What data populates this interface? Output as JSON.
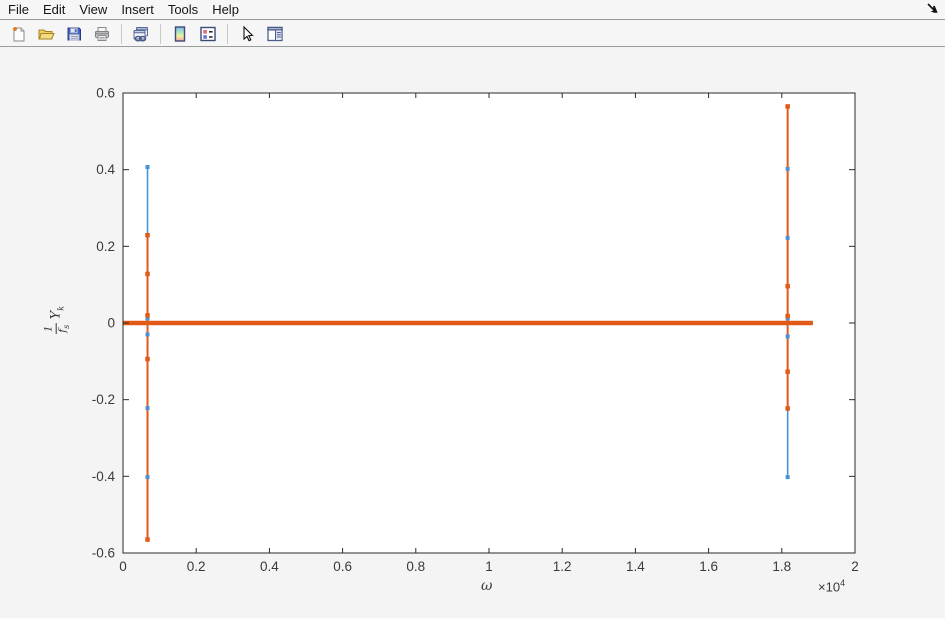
{
  "menubar": {
    "items": [
      {
        "label": "File"
      },
      {
        "label": "Edit"
      },
      {
        "label": "View"
      },
      {
        "label": "Insert"
      },
      {
        "label": "Tools"
      },
      {
        "label": "Help"
      }
    ]
  },
  "toolbar": {
    "icons": [
      "new-document-icon",
      "open-folder-icon",
      "save-icon",
      "print-icon",
      "linked-windows-icon",
      "colorbar-icon",
      "legend-icon",
      "pointer-icon",
      "panel-icon"
    ]
  },
  "plot": {
    "xlabel": "ω",
    "x_multiplier_base": "×10",
    "x_multiplier_exp": "4",
    "ylabel": {
      "num": "1",
      "den_base": "f",
      "den_sub": "s",
      "sym_base": "Y",
      "sym_sub": "k"
    }
  },
  "chart_data": {
    "type": "line",
    "title": "",
    "xlabel": "ω",
    "ylabel": "(1/f_s) Y_k",
    "xlim": [
      0,
      20000
    ],
    "ylim": [
      -0.6,
      0.6
    ],
    "x_multiplier": "×10^4",
    "x_ticks": [
      0,
      2000,
      4000,
      6000,
      8000,
      10000,
      12000,
      14000,
      16000,
      18000,
      20000
    ],
    "x_tick_labels": [
      "0",
      "0.2",
      "0.4",
      "0.6",
      "0.8",
      "1",
      "1.2",
      "1.4",
      "1.6",
      "1.8",
      "2"
    ],
    "y_ticks": [
      0.6,
      0.4,
      0.2,
      0,
      -0.2,
      -0.4,
      -0.6
    ],
    "y_tick_labels": [
      "0.6",
      "0.4",
      "0.2",
      "0",
      "-0.2",
      "-0.4",
      "-0.6"
    ],
    "grid": false,
    "legend": "none",
    "axis_color": "#2a2a2a",
    "tick_label_color": "#3a3a3a",
    "plot_bg": "#ffffff",
    "figure_bg": "#f4f4f5",
    "series": [
      {
        "name": "series-blue",
        "color": "#4b92d4",
        "line_width": 1.6,
        "marker": "square-dot",
        "marker_size": 4,
        "baseline": {
          "x": [
            0,
            18850
          ],
          "y": 0,
          "width": 1.5
        },
        "stems": [
          {
            "x": 670,
            "y1": -0.402,
            "y2": 0.407
          },
          {
            "x": 18160,
            "y1": -0.402,
            "y2": 0.402
          }
        ],
        "markers": [
          [
            670,
            0.407
          ],
          [
            670,
            0.012
          ],
          [
            670,
            -0.03
          ],
          [
            670,
            -0.222
          ],
          [
            670,
            -0.402
          ],
          [
            18160,
            0.402
          ],
          [
            18160,
            0.222
          ],
          [
            18160,
            0.012
          ],
          [
            18160,
            -0.035
          ],
          [
            18160,
            -0.402
          ]
        ]
      },
      {
        "name": "series-orange",
        "color": "#e35a18",
        "line_width": 2,
        "marker": "square-dot",
        "marker_size": 4.5,
        "baseline": {
          "x": [
            0,
            18850
          ],
          "y": 0,
          "width": 4.4
        },
        "stems": [
          {
            "x": 670,
            "y1": -0.565,
            "y2": 0.229
          },
          {
            "x": 18160,
            "y1": -0.223,
            "y2": 0.565
          }
        ],
        "markers": [
          [
            670,
            0.229
          ],
          [
            670,
            0.128
          ],
          [
            670,
            0.02
          ],
          [
            670,
            -0.094
          ],
          [
            670,
            -0.565
          ],
          [
            18160,
            0.565
          ],
          [
            18160,
            0.096
          ],
          [
            18160,
            0.018
          ],
          [
            18160,
            -0.127
          ],
          [
            18160,
            -0.223
          ]
        ]
      }
    ]
  }
}
